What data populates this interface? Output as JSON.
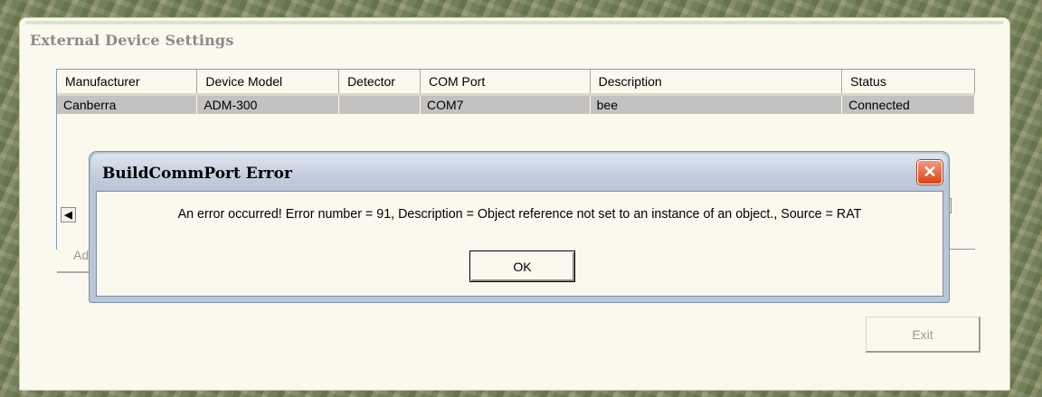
{
  "settings_window": {
    "title": "External Device Settings",
    "table": {
      "columns": [
        "Manufacturer",
        "Device Model",
        "Detector",
        "COM Port",
        "Description",
        "Status"
      ],
      "rows": [
        [
          "Canberra",
          "ADM-300",
          "",
          "COM7",
          "bee",
          "Connected"
        ]
      ]
    },
    "add_label": "Add",
    "exit_label": "Exit"
  },
  "error_dialog": {
    "title": "BuildCommPort Error",
    "message": "An error occurred! Error number = 91, Description = Object reference not set to an instance of an object., Source = RAT",
    "ok_label": "OK"
  },
  "icons": {
    "close": "close-icon",
    "scroll_left": "scroll-left-icon",
    "scroll_right": "scroll-right-icon"
  },
  "colors": {
    "window_bg": "#fbf8ee",
    "selected_row": "#c4c2c0",
    "close_button": "#d8431c",
    "dialog_frame": "#b9c6d8"
  }
}
